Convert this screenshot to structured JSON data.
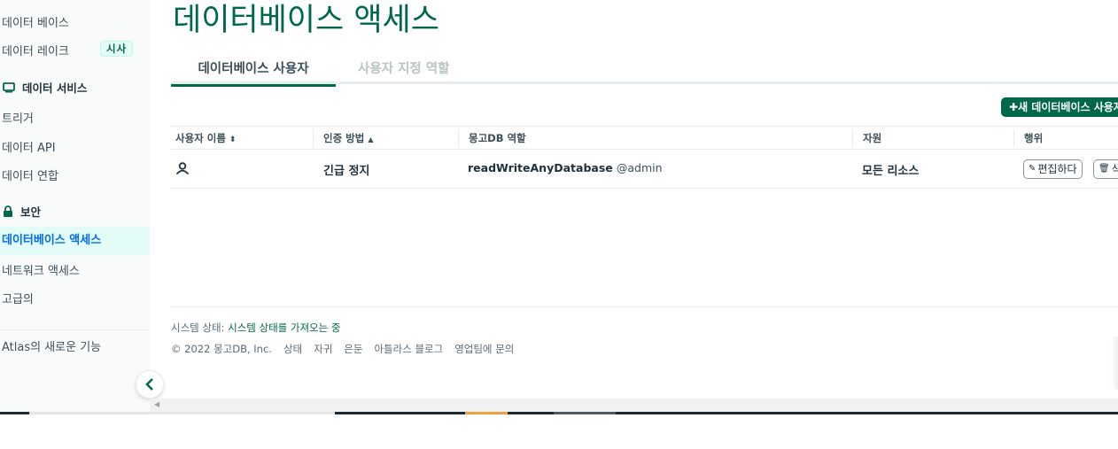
{
  "sidebar": {
    "items": [
      {
        "label": "데이터 베이스"
      },
      {
        "label": "데이터 레이크",
        "badge": "시사"
      },
      {
        "section": "데이터 서비스"
      },
      {
        "label": "트리거"
      },
      {
        "label": "데이터 API"
      },
      {
        "label": "데이터 연합"
      },
      {
        "section": "보안"
      },
      {
        "label": "데이터베이스 액세스",
        "active": true
      },
      {
        "label": "네트워크 액세스"
      },
      {
        "label": "고급의"
      },
      {
        "label": "Atlas의 새로운 기능"
      }
    ]
  },
  "page": {
    "title": "데이터베이스 액세스"
  },
  "tabs": [
    {
      "label": "데이터베이스 사용자",
      "active": true
    },
    {
      "label": "사용자 지정 역할",
      "active": false
    }
  ],
  "toolbar": {
    "add_label": "새 데이터베이스 사용자 추가"
  },
  "table": {
    "headers": [
      "사용자 이름",
      "인증 방법",
      "몽고DB 역할",
      "자원",
      "행위"
    ],
    "rows": [
      {
        "auth_method": "긴급 정지",
        "role": "readWriteAnyDatabase",
        "role_db": "@admin",
        "resources": "모든 리소스",
        "edit_label": "편집하다",
        "delete_label": "삭제"
      }
    ]
  },
  "footer": {
    "status_label": "시스템 상태:",
    "status_value": "시스템 상태를 가져오는 중",
    "copyright": "© 2022 몽고DB, Inc.",
    "links": [
      "상태",
      "자귀",
      "은둔",
      "아틀라스 블로그",
      "영업팀에 문의"
    ]
  },
  "colors": {
    "brand": "#00684a",
    "active_nav": "#016bf8",
    "active_bg": "#e3fcf7"
  }
}
